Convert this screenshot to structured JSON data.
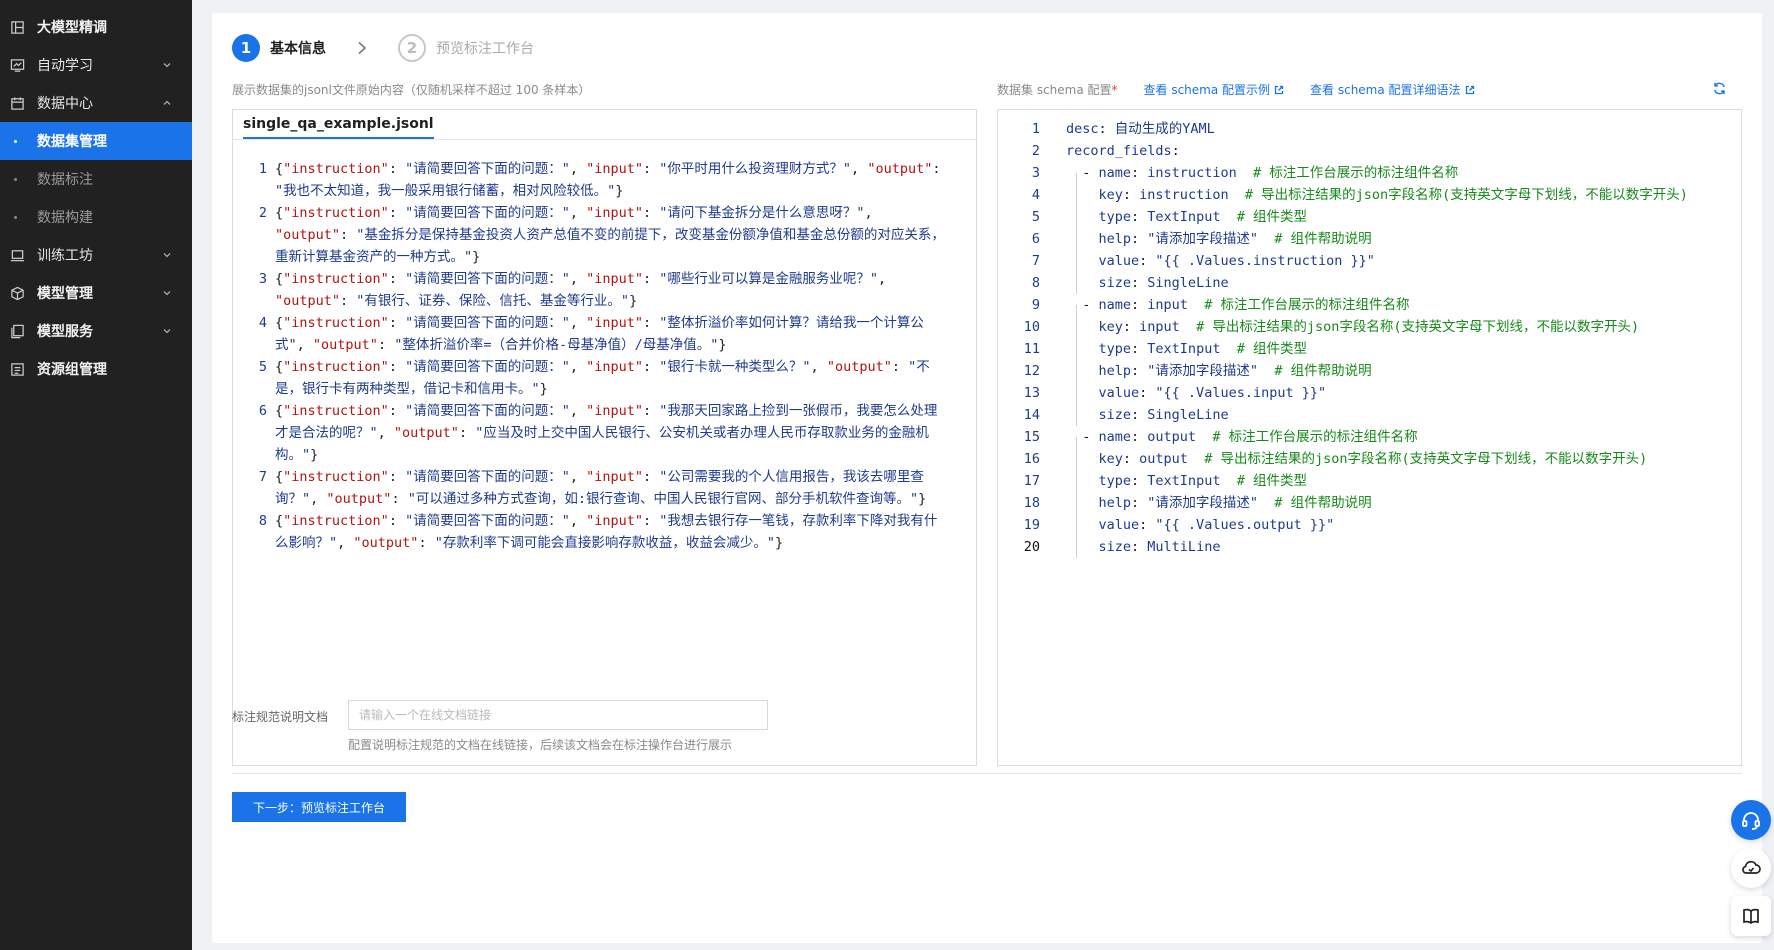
{
  "sidebar": {
    "items": [
      {
        "label": "大模型精调",
        "icon": "tune-icon",
        "bold": true
      },
      {
        "label": "自动学习",
        "icon": "monitor-chart-icon",
        "expandable": true,
        "expanded": false
      },
      {
        "label": "数据中心",
        "icon": "calendar-icon",
        "expandable": true,
        "expanded": true
      },
      {
        "label": "训练工坊",
        "icon": "laptop-icon",
        "expandable": true,
        "expanded": false
      },
      {
        "label": "模型管理",
        "icon": "cube-icon",
        "expandable": true,
        "expanded": false
      },
      {
        "label": "模型服务",
        "icon": "copy-icon",
        "expandable": true,
        "expanded": false
      },
      {
        "label": "资源组管理",
        "icon": "list-icon",
        "bold": true
      }
    ],
    "sub_items": [
      {
        "label": "数据集管理",
        "active": true
      },
      {
        "label": "数据标注",
        "active": false
      },
      {
        "label": "数据构建",
        "active": false
      }
    ]
  },
  "steps": [
    {
      "num": "1",
      "label": "基本信息",
      "active": true
    },
    {
      "num": "2",
      "label": "预览标注工作台",
      "active": false
    }
  ],
  "left_hint": "展示数据集的jsonl文件原始内容（仅随机采样不超过 100 条样本）",
  "file_tab": "single_qa_example.jsonl",
  "jsonl_lines": [
    {
      "n": "1",
      "instruction": "请简要回答下面的问题：",
      "input": "你平时用什么投资理财方式？",
      "output": "我也不太知道，我一般采用银行储蓄，相对风险较低。"
    },
    {
      "n": "2",
      "instruction": "请简要回答下面的问题：",
      "input": "请问下基金拆分是什么意思呀？",
      "output": "基金拆分是保持基金投资人资产总值不变的前提下，改变基金份额净值和基金总份额的对应关系，重新计算基金资产的一种方式。"
    },
    {
      "n": "3",
      "instruction": "请简要回答下面的问题：",
      "input": "哪些行业可以算是金融服务业呢？",
      "output": "有银行、证券、保险、信托、基金等行业。"
    },
    {
      "n": "4",
      "instruction": "请简要回答下面的问题：",
      "input": "整体折溢价率如何计算？请给我一个计算公式",
      "output": "整体折溢价率=（合并价格-母基净值）/母基净值。"
    },
    {
      "n": "5",
      "instruction": "请简要回答下面的问题：",
      "input": "银行卡就一种类型么？",
      "output": "不是，银行卡有两种类型，借记卡和信用卡。"
    },
    {
      "n": "6",
      "instruction": "请简要回答下面的问题：",
      "input": "我那天回家路上捡到一张假币，我要怎么处理才是合法的呢？",
      "output": "应当及时上交中国人民银行、公安机关或者办理人民币存取款业务的金融机构。"
    },
    {
      "n": "7",
      "instruction": "请简要回答下面的问题：",
      "input": "公司需要我的个人信用报告，我该去哪里查询？",
      "output": "可以通过多种方式查询，如:银行查询、中国人民银行官网、部分手机软件查询等。"
    },
    {
      "n": "8",
      "instruction": "请简要回答下面的问题：",
      "input": "我想去银行存一笔钱，存款利率下降对我有什么影响？",
      "output": "存款利率下调可能会直接影响存款收益，收益会减少。"
    }
  ],
  "schema": {
    "label": "数据集 schema 配置",
    "required_mark": "*",
    "link_example": "查看 schema 配置示例",
    "link_syntax": "查看 schema 配置详细语法",
    "current_line": 20
  },
  "yaml_lines": [
    [
      {
        "t": "desc",
        "c": "yk"
      },
      {
        "t": ": ",
        "c": "yp"
      },
      {
        "t": "自动生成的YAML",
        "c": "yv"
      }
    ],
    [
      {
        "t": "record_fields",
        "c": "yk"
      },
      {
        "t": ":",
        "c": "yp"
      }
    ],
    [
      {
        "t": "  - ",
        "c": "yp"
      },
      {
        "t": "name",
        "c": "yk"
      },
      {
        "t": ": ",
        "c": "yp"
      },
      {
        "t": "instruction",
        "c": "yv"
      },
      {
        "t": "  # 标注工作台展示的标注组件名称",
        "c": "yc"
      }
    ],
    [
      {
        "t": "    ",
        "c": "yp"
      },
      {
        "t": "key",
        "c": "yk"
      },
      {
        "t": ": ",
        "c": "yp"
      },
      {
        "t": "instruction",
        "c": "yv"
      },
      {
        "t": "  # 导出标注结果的json字段名称(支持英文字母下划线，不能以数字开头)",
        "c": "yc"
      }
    ],
    [
      {
        "t": "    ",
        "c": "yp"
      },
      {
        "t": "type",
        "c": "yk"
      },
      {
        "t": ": ",
        "c": "yp"
      },
      {
        "t": "TextInput",
        "c": "yv"
      },
      {
        "t": "  # 组件类型",
        "c": "yc"
      }
    ],
    [
      {
        "t": "    ",
        "c": "yp"
      },
      {
        "t": "help",
        "c": "yk"
      },
      {
        "t": ": ",
        "c": "yp"
      },
      {
        "t": "\"请添加字段描述\"",
        "c": "ys"
      },
      {
        "t": "  # 组件帮助说明",
        "c": "yc"
      }
    ],
    [
      {
        "t": "    ",
        "c": "yp"
      },
      {
        "t": "value",
        "c": "yk"
      },
      {
        "t": ": ",
        "c": "yp"
      },
      {
        "t": "\"{{ .Values.instruction }}\"",
        "c": "ys"
      }
    ],
    [
      {
        "t": "    ",
        "c": "yp"
      },
      {
        "t": "size",
        "c": "yk"
      },
      {
        "t": ": ",
        "c": "yp"
      },
      {
        "t": "SingleLine",
        "c": "yv"
      }
    ],
    [
      {
        "t": "  - ",
        "c": "yp"
      },
      {
        "t": "name",
        "c": "yk"
      },
      {
        "t": ": ",
        "c": "yp"
      },
      {
        "t": "input",
        "c": "yv"
      },
      {
        "t": "  # 标注工作台展示的标注组件名称",
        "c": "yc"
      }
    ],
    [
      {
        "t": "    ",
        "c": "yp"
      },
      {
        "t": "key",
        "c": "yk"
      },
      {
        "t": ": ",
        "c": "yp"
      },
      {
        "t": "input",
        "c": "yv"
      },
      {
        "t": "  # 导出标注结果的json字段名称(支持英文字母下划线，不能以数字开头)",
        "c": "yc"
      }
    ],
    [
      {
        "t": "    ",
        "c": "yp"
      },
      {
        "t": "type",
        "c": "yk"
      },
      {
        "t": ": ",
        "c": "yp"
      },
      {
        "t": "TextInput",
        "c": "yv"
      },
      {
        "t": "  # 组件类型",
        "c": "yc"
      }
    ],
    [
      {
        "t": "    ",
        "c": "yp"
      },
      {
        "t": "help",
        "c": "yk"
      },
      {
        "t": ": ",
        "c": "yp"
      },
      {
        "t": "\"请添加字段描述\"",
        "c": "ys"
      },
      {
        "t": "  # 组件帮助说明",
        "c": "yc"
      }
    ],
    [
      {
        "t": "    ",
        "c": "yp"
      },
      {
        "t": "value",
        "c": "yk"
      },
      {
        "t": ": ",
        "c": "yp"
      },
      {
        "t": "\"{{ .Values.input }}\"",
        "c": "ys"
      }
    ],
    [
      {
        "t": "    ",
        "c": "yp"
      },
      {
        "t": "size",
        "c": "yk"
      },
      {
        "t": ": ",
        "c": "yp"
      },
      {
        "t": "SingleLine",
        "c": "yv"
      }
    ],
    [
      {
        "t": "  - ",
        "c": "yp"
      },
      {
        "t": "name",
        "c": "yk"
      },
      {
        "t": ": ",
        "c": "yp"
      },
      {
        "t": "output",
        "c": "yv"
      },
      {
        "t": "  # 标注工作台展示的标注组件名称",
        "c": "yc"
      }
    ],
    [
      {
        "t": "    ",
        "c": "yp"
      },
      {
        "t": "key",
        "c": "yk"
      },
      {
        "t": ": ",
        "c": "yp"
      },
      {
        "t": "output",
        "c": "yv"
      },
      {
        "t": "  # 导出标注结果的json字段名称(支持英文字母下划线，不能以数字开头)",
        "c": "yc"
      }
    ],
    [
      {
        "t": "    ",
        "c": "yp"
      },
      {
        "t": "type",
        "c": "yk"
      },
      {
        "t": ": ",
        "c": "yp"
      },
      {
        "t": "TextInput",
        "c": "yv"
      },
      {
        "t": "  # 组件类型",
        "c": "yc"
      }
    ],
    [
      {
        "t": "    ",
        "c": "yp"
      },
      {
        "t": "help",
        "c": "yk"
      },
      {
        "t": ": ",
        "c": "yp"
      },
      {
        "t": "\"请添加字段描述\"",
        "c": "ys"
      },
      {
        "t": "  # 组件帮助说明",
        "c": "yc"
      }
    ],
    [
      {
        "t": "    ",
        "c": "yp"
      },
      {
        "t": "value",
        "c": "yk"
      },
      {
        "t": ": ",
        "c": "yp"
      },
      {
        "t": "\"{{ .Values.output }}\"",
        "c": "ys"
      }
    ],
    [
      {
        "t": "    ",
        "c": "yp"
      },
      {
        "t": "size",
        "c": "yk"
      },
      {
        "t": ": ",
        "c": "yp"
      },
      {
        "t": "MultiLine",
        "c": "yv"
      }
    ]
  ],
  "form": {
    "label": "标注规范说明文档",
    "placeholder": "请输入一个在线文档链接",
    "help": "配置说明标注规范的文档在线链接，后续该文档会在标注操作台进行展示"
  },
  "next_button": "下一步：预览标注工作台",
  "floating": [
    "headset-icon",
    "cloud-icon",
    "book-icon"
  ],
  "colors": {
    "accent": "#1a73e8",
    "sidebar_bg": "#212121",
    "key_red": "#b31412",
    "comment_green": "#178a1a"
  }
}
